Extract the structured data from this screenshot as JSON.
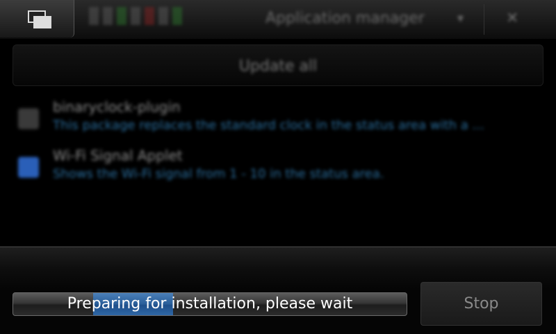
{
  "topbar": {
    "window_title": "Application manager",
    "menu_icon": "chevron-down-icon",
    "task_switcher_icon": "task-switcher-icon",
    "close_icon": "close-icon"
  },
  "main": {
    "update_all_label": "Update all",
    "packages": [
      {
        "name": "binaryclock-plugin",
        "description": "This package replaces the standard clock in the status area with a ...",
        "icon": "package-icon",
        "icon_color": "#3a3a3a"
      },
      {
        "name": "Wi-Fi Signal Applet",
        "description": "Shows the Wi-Fi signal from 1 - 10 in the status area.",
        "icon": "wifi-applet-icon",
        "icon_color": "#2a5fb8"
      }
    ]
  },
  "dialog": {
    "progress_text": "Preparing for installation, please wait",
    "progress_state": "indeterminate",
    "stop_label": "Stop",
    "accent_color": "#2f67a6"
  }
}
